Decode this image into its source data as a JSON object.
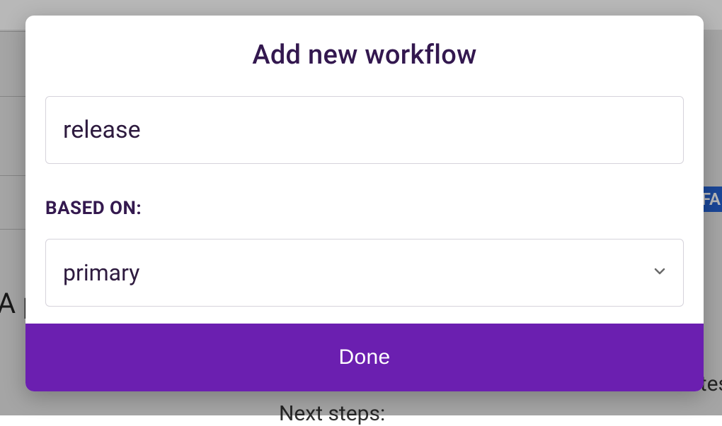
{
  "modal": {
    "title": "Add new workflow",
    "name_input_value": "release",
    "based_on_label": "BASED ON:",
    "based_on_value": "primary",
    "done_label": "Done"
  },
  "background": {
    "badge_fragment": "EFA",
    "left_text": "A p",
    "bottom_text": "Next steps:",
    "right_text": "tes"
  }
}
